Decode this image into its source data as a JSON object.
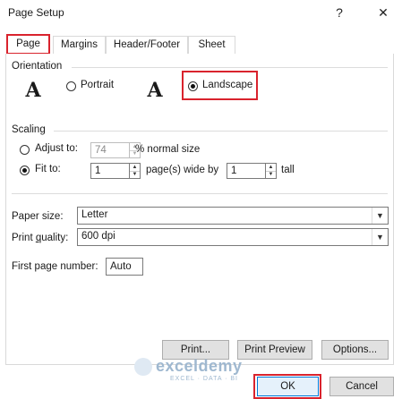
{
  "window": {
    "title": "Page Setup",
    "help_symbol": "?",
    "close_symbol": "✕"
  },
  "tabs": [
    {
      "label": "Page",
      "active": true
    },
    {
      "label": "Margins",
      "active": false
    },
    {
      "label": "Header/Footer",
      "active": false
    },
    {
      "label": "Sheet",
      "active": false
    }
  ],
  "orientation": {
    "section_label": "Orientation",
    "icon_glyph": "A",
    "portrait_label": "Portrait",
    "landscape_label": "Landscape",
    "selected": "Landscape"
  },
  "scaling": {
    "section_label": "Scaling",
    "adjust_to_label": "Adjust to:",
    "adjust_value": "74",
    "normal_size_label": "% normal size",
    "fit_to_label": "Fit to:",
    "fit_wide_value": "1",
    "pages_wide_label": "page(s) wide by",
    "fit_tall_value": "1",
    "tall_label": "tall",
    "selected": "Fit to"
  },
  "paper": {
    "paper_size_label": "Paper size:",
    "paper_size_value": "Letter",
    "print_quality_label": "Print quality:",
    "print_quality_value": "600 dpi",
    "first_page_label": "First page number:",
    "first_page_value": "Auto"
  },
  "buttons": {
    "print": "Print...",
    "print_preview": "Print Preview",
    "options": "Options...",
    "ok": "OK",
    "cancel": "Cancel"
  },
  "watermark": {
    "name": "exceldemy",
    "tagline": "EXCEL · DATA · BI"
  },
  "colors": {
    "highlight": "#d9232d",
    "button_face": "#e1e1e1",
    "border": "#7a7a7a"
  }
}
